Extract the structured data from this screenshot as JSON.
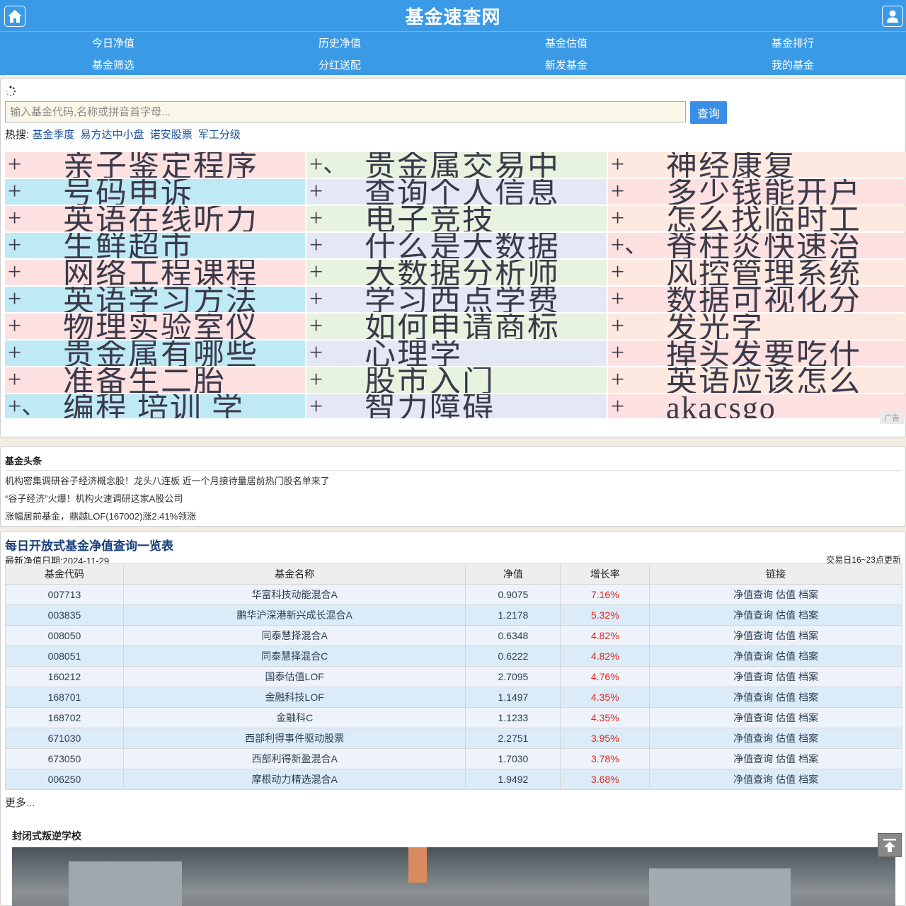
{
  "header": {
    "title": "基金速查网",
    "home_icon": "home-icon",
    "user_icon": "user-icon"
  },
  "nav": [
    {
      "label": "今日净值"
    },
    {
      "label": "历史净值"
    },
    {
      "label": "基金估值"
    },
    {
      "label": "基金排行"
    },
    {
      "label": "基金筛选"
    },
    {
      "label": "分红送配"
    },
    {
      "label": "新发基金"
    },
    {
      "label": "我的基金"
    }
  ],
  "search": {
    "placeholder": "输入基金代码,名称或拼音首字母...",
    "button": "查询",
    "hot_label": "热搜:",
    "hot_items": [
      "基金季度",
      "易方达中小盘",
      "诺安股票",
      "军工分级"
    ]
  },
  "ads": {
    "items": [
      {
        "plus": "+",
        "text": "亲子鉴定程序",
        "color": "pink"
      },
      {
        "plus": "+、",
        "text": "贵金属交易中",
        "color": "green"
      },
      {
        "plus": "+",
        "text": "神经康复",
        "color": "peach"
      },
      {
        "plus": "+",
        "text": "号码申诉",
        "color": "cyan"
      },
      {
        "plus": "+",
        "text": "查询个人信息",
        "color": "lav"
      },
      {
        "plus": "+",
        "text": "多少钱能开户",
        "color": "pink"
      },
      {
        "plus": "+",
        "text": "英语在线听力",
        "color": "pink"
      },
      {
        "plus": "+",
        "text": "电子竞技",
        "color": "green"
      },
      {
        "plus": "+",
        "text": "怎么找临时工",
        "color": "peach"
      },
      {
        "plus": "+",
        "text": "生鲜超市",
        "color": "cyan"
      },
      {
        "plus": "+",
        "text": "什么是大数据",
        "color": "lav"
      },
      {
        "plus": "+、",
        "text": "脊柱炎快速治",
        "color": "pink"
      },
      {
        "plus": "+",
        "text": "网络工程课程",
        "color": "pink"
      },
      {
        "plus": "+",
        "text": "大数据分析师",
        "color": "green"
      },
      {
        "plus": "+",
        "text": "风控管理系统",
        "color": "peach"
      },
      {
        "plus": "+",
        "text": "英语学习方法",
        "color": "cyan"
      },
      {
        "plus": "+",
        "text": "学习西点学费",
        "color": "lav"
      },
      {
        "plus": "+",
        "text": "数据可视化分",
        "color": "pink"
      },
      {
        "plus": "+",
        "text": "物理实验室仪",
        "color": "pink"
      },
      {
        "plus": "+",
        "text": "如何申请商标",
        "color": "green"
      },
      {
        "plus": "+",
        "text": "发光字",
        "color": "peach"
      },
      {
        "plus": "+",
        "text": "贵金属有哪些",
        "color": "cyan"
      },
      {
        "plus": "+",
        "text": "心理学",
        "color": "lav"
      },
      {
        "plus": "+",
        "text": "掉头发要吃什",
        "color": "pink"
      },
      {
        "plus": "+",
        "text": "准备生二胎",
        "color": "pink"
      },
      {
        "plus": "+",
        "text": "股市入门",
        "color": "green"
      },
      {
        "plus": "+",
        "text": "英语应该怎么",
        "color": "peach"
      },
      {
        "plus": "+、",
        "text": "编程 培训 学",
        "color": "cyan"
      },
      {
        "plus": "+",
        "text": "智力障碍",
        "color": "lav"
      },
      {
        "plus": "+",
        "text": "akacsgo",
        "color": "pink"
      }
    ],
    "badge": "广告"
  },
  "news": {
    "title": "基金头条",
    "items": [
      "机构密集调研谷子经济概念股！龙头八连板 近一个月接待量居前热门股名单来了",
      "“谷子经济”火爆！机构火速调研这家A股公司",
      "涨幅居前基金，鼎越LOF(167002)涨2.41%领涨"
    ]
  },
  "funds": {
    "heading": "每日开放式基金净值查询一览表",
    "date_label": "最新净值日期:2024-11-29",
    "update_note": "交易日16~23点更新",
    "columns": [
      "基金代码",
      "基金名称",
      "净值",
      "增长率",
      "链接"
    ],
    "links": [
      "净值查询",
      "估值",
      "档案"
    ],
    "rows": [
      {
        "code": "007713",
        "name": "华富科技动能混合A",
        "nav": "0.9075",
        "rate": "7.16%"
      },
      {
        "code": "003835",
        "name": "鹏华沪深港新兴成长混合A",
        "nav": "1.2178",
        "rate": "5.32%"
      },
      {
        "code": "008050",
        "name": "同泰慧择混合A",
        "nav": "0.6348",
        "rate": "4.82%"
      },
      {
        "code": "008051",
        "name": "同泰慧择混合C",
        "nav": "0.6222",
        "rate": "4.82%"
      },
      {
        "code": "160212",
        "name": "国泰估值LOF",
        "nav": "2.7095",
        "rate": "4.76%"
      },
      {
        "code": "168701",
        "name": "金融科技LOF",
        "nav": "1.1497",
        "rate": "4.35%"
      },
      {
        "code": "168702",
        "name": "金融科C",
        "nav": "1.1233",
        "rate": "4.35%"
      },
      {
        "code": "671030",
        "name": "西部利得事件驱动股票",
        "nav": "2.2751",
        "rate": "3.95%"
      },
      {
        "code": "673050",
        "name": "西部利得新盈混合A",
        "nav": "1.7030",
        "rate": "3.78%"
      },
      {
        "code": "006250",
        "name": "摩根动力精选混合A",
        "nav": "1.9492",
        "rate": "3.68%"
      }
    ],
    "more": "更多..."
  },
  "promo": {
    "title": "封闭式叛逆学校"
  },
  "colors": {
    "header_bg": "#3b9ae6",
    "rate_red": "#e0261d",
    "link_blue": "#1a4f9e"
  }
}
